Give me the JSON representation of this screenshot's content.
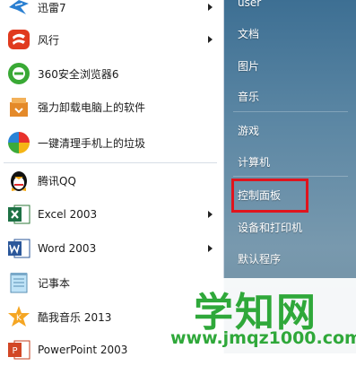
{
  "programs": [
    {
      "label": "迅雷7",
      "icon": "thunder-bird-icon",
      "arrow": true
    },
    {
      "label": "风行",
      "icon": "funshion-icon",
      "arrow": true
    },
    {
      "label": "360安全浏览器6",
      "icon": "360-browser-icon",
      "arrow": false
    },
    {
      "label": "强力卸载电脑上的软件",
      "icon": "uninstall-box-icon",
      "arrow": false
    },
    {
      "label": "一键清理手机上的垃圾",
      "icon": "phone-cleaner-icon",
      "arrow": false
    },
    {
      "label": "腾讯QQ",
      "icon": "qq-penguin-icon",
      "arrow": false
    },
    {
      "label": "Excel 2003",
      "icon": "excel-icon",
      "arrow": true
    },
    {
      "label": "Word 2003",
      "icon": "word-icon",
      "arrow": true
    },
    {
      "label": "记事本",
      "icon": "notepad-icon",
      "arrow": false
    },
    {
      "label": "酷我音乐 2013",
      "icon": "kuwo-music-icon",
      "arrow": false
    },
    {
      "label": "PowerPoint 2003",
      "icon": "powerpoint-icon",
      "arrow": false
    }
  ],
  "right_menu": {
    "user": "user",
    "documents": "文档",
    "pictures": "图片",
    "music": "音乐",
    "games": "游戏",
    "computer": "计算机",
    "control_panel": "控制面板",
    "devices_printers": "设备和打印机",
    "default_programs": "默认程序"
  },
  "watermark": {
    "title": "学知网",
    "url": "www.jmqz1000.com"
  },
  "colors": {
    "highlight_border": "#e0141d",
    "watermark_green": "#2fa83a"
  }
}
